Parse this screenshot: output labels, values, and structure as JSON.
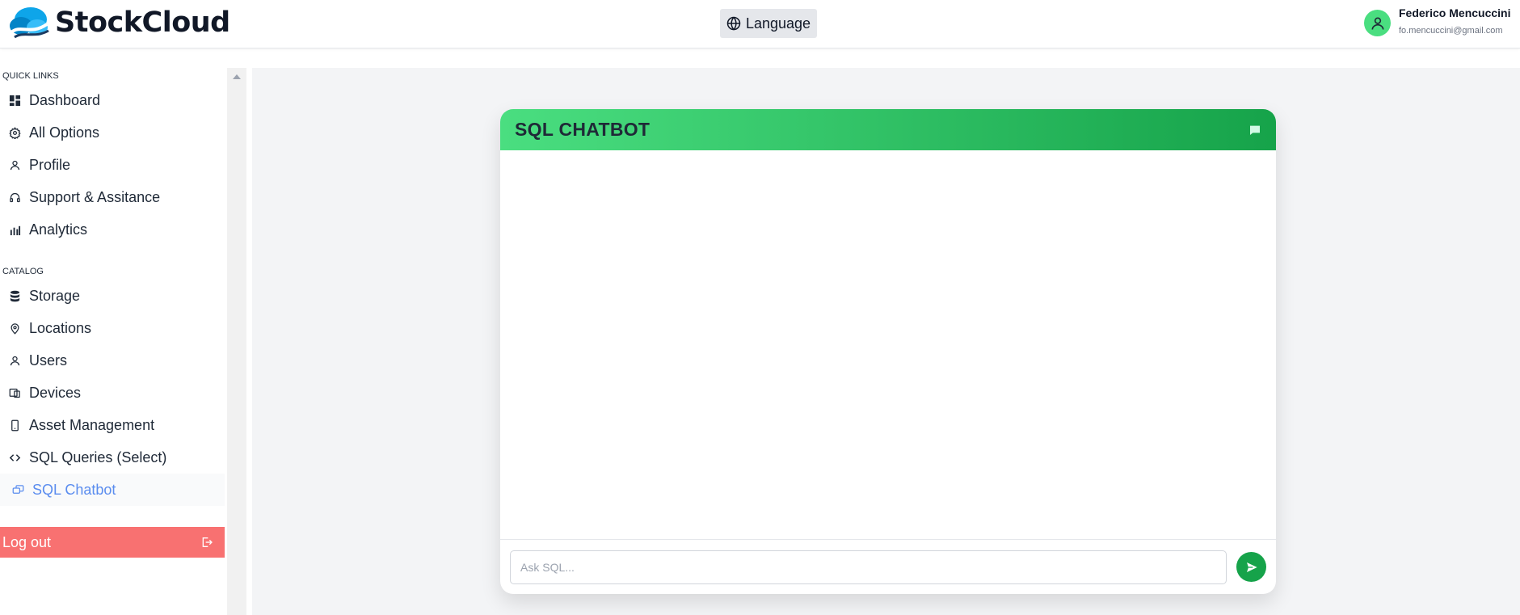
{
  "app": {
    "name": "StockCloud"
  },
  "header": {
    "language_label": "Language",
    "user": {
      "name": "Federico Mencuccini",
      "email": "fo.mencuccini@gmail.com"
    }
  },
  "sidebar": {
    "quick_links_title": "QUICK LINKS",
    "quick_links": [
      {
        "label": "Dashboard",
        "icon": "grid-icon"
      },
      {
        "label": "All Options",
        "icon": "gear-icon"
      },
      {
        "label": "Profile",
        "icon": "user-icon"
      },
      {
        "label": "Support & Assitance",
        "icon": "headset-icon"
      },
      {
        "label": "Analytics",
        "icon": "bar-chart-icon"
      }
    ],
    "catalog_title": "CATALOG",
    "catalog": [
      {
        "label": "Storage",
        "icon": "database-icon"
      },
      {
        "label": "Locations",
        "icon": "map-pin-icon"
      },
      {
        "label": "Users",
        "icon": "user-icon"
      },
      {
        "label": "Devices",
        "icon": "devices-icon"
      },
      {
        "label": "Asset Management",
        "icon": "phone-icon"
      },
      {
        "label": "SQL Queries (Select)",
        "icon": "code-icon"
      },
      {
        "label": "SQL Chatbot",
        "icon": "chat-bubbles-icon",
        "active": true
      }
    ],
    "logout_label": "Log out"
  },
  "chat": {
    "title": "SQL CHATBOT",
    "input_placeholder": "Ask SQL...",
    "input_value": ""
  },
  "colors": {
    "accent_green": "#16a34a",
    "header_gradient_start": "#4ade80",
    "logout_red": "#f87171",
    "active_blue": "#5b8def"
  }
}
